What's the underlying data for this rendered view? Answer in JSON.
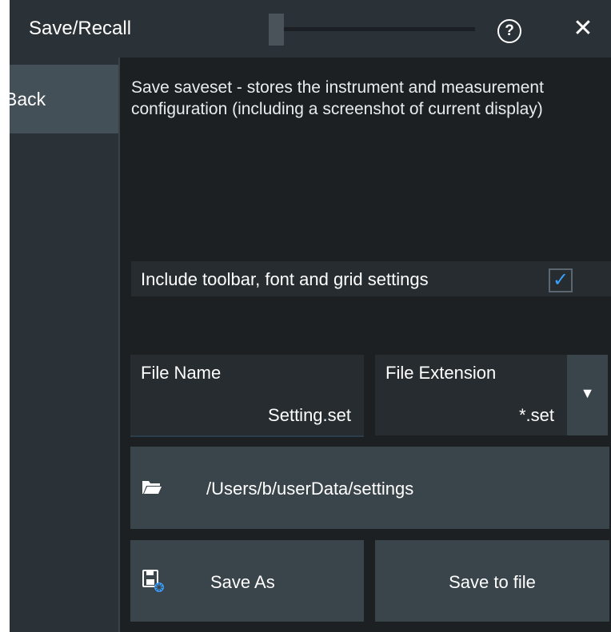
{
  "titlebar": {
    "title": "Save/Recall",
    "help_glyph": "?",
    "close_glyph": "✕",
    "icons": [
      "help-icon",
      "close-icon"
    ]
  },
  "sidebar": {
    "back_label": "Back"
  },
  "main": {
    "description": "Save saveset - stores the instrument and measurement configuration (including a screenshot of current display)",
    "include_settings": {
      "label": "Include toolbar, font and grid settings",
      "checked": true,
      "check_glyph": "✓"
    },
    "file_name": {
      "title": "File Name",
      "value": "Setting.set"
    },
    "file_extension": {
      "title": "File Extension",
      "value": "*.set",
      "dropdown_glyph": "▼"
    },
    "path": {
      "icon": "folder-icon",
      "value": "/Users/b/userData/settings"
    },
    "buttons": {
      "save_as": "Save As",
      "save_as_icon": "save-as-icon",
      "save_to_file": "Save to file"
    }
  },
  "colors": {
    "background": "#1d2022",
    "panel": "#2b3237",
    "button": "#3a444b",
    "selected": "#435058",
    "accent": "#3aa0ff"
  }
}
